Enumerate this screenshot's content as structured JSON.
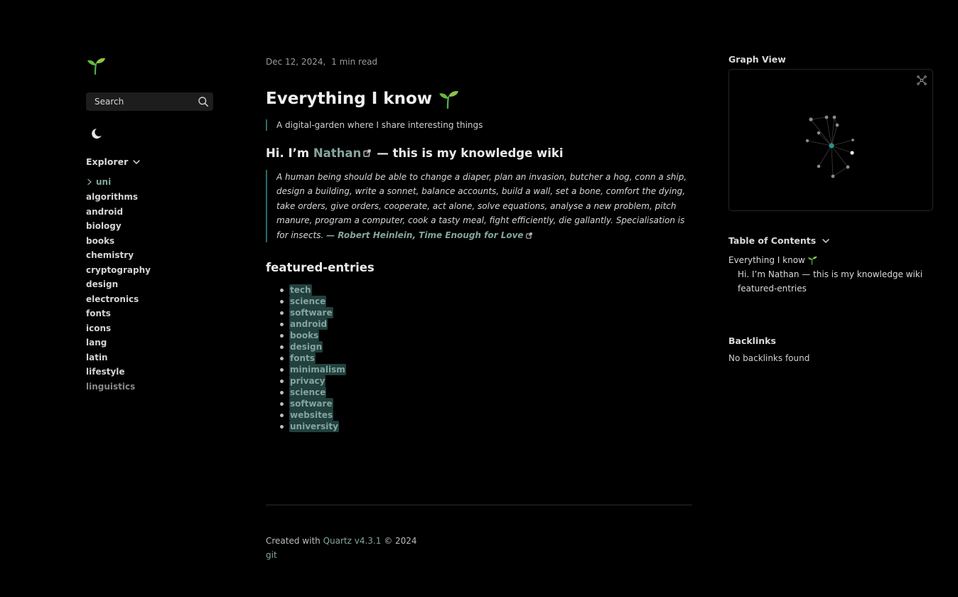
{
  "sidebar": {
    "search_label": "Search",
    "explorer_title": "Explorer",
    "folder": "uni",
    "items": [
      "algorithms",
      "android",
      "biology",
      "books",
      "chemistry",
      "cryptography",
      "design",
      "electronics",
      "fonts",
      "icons",
      "lang",
      "latin",
      "lifestyle",
      "linguistics"
    ]
  },
  "article": {
    "date": "Dec 12, 2024,",
    "read_time": "1 min read",
    "title": "Everything I know",
    "description": "A digital-garden where I share interesting things",
    "intro_prefix": "Hi. I’m ",
    "intro_link": "Nathan",
    "intro_suffix": "— this is my knowledge wiki",
    "quote": "A human being should be able to change a diaper, plan an invasion, butcher a hog, conn a ship, design a building, write a sonnet, balance accounts, build a wall, set a bone, comfort the dying, take orders, give orders, cooperate, act alone, solve equations, analyse a new problem, pitch manure, program a computer, cook a tasty meal, fight efficiently, die gallantly. Specialisation is for insects. ",
    "quote_cite": "— Robert Heinlein, Time Enough for Love",
    "featured_heading": "featured-entries",
    "entries": [
      "tech",
      "science",
      "software",
      "android",
      "books",
      "design",
      "fonts",
      "minimalism",
      "privacy",
      "science",
      "software",
      "websites",
      "university"
    ]
  },
  "footer": {
    "created_prefix": "Created with ",
    "quartz_link": "Quartz v4.3.1",
    "copyright": " © 2024",
    "git_link": "git"
  },
  "right": {
    "graph_title": "Graph View",
    "toc_title": "Table of Contents",
    "toc_items": [
      "Everything I know",
      "Hi. I’m Nathan — this is my knowledge wiki",
      "featured-entries"
    ],
    "backlinks_title": "Backlinks",
    "backlinks_empty": "No backlinks found"
  },
  "colors": {
    "accent": "#84a59d",
    "tag_bg": "#21403e",
    "graph_center": "#2f8f8a"
  },
  "icons": {
    "logo": "sprout-icon",
    "search": "search-icon",
    "darkmode": "moon-icon",
    "global_graph": "globe-graph-icon"
  }
}
